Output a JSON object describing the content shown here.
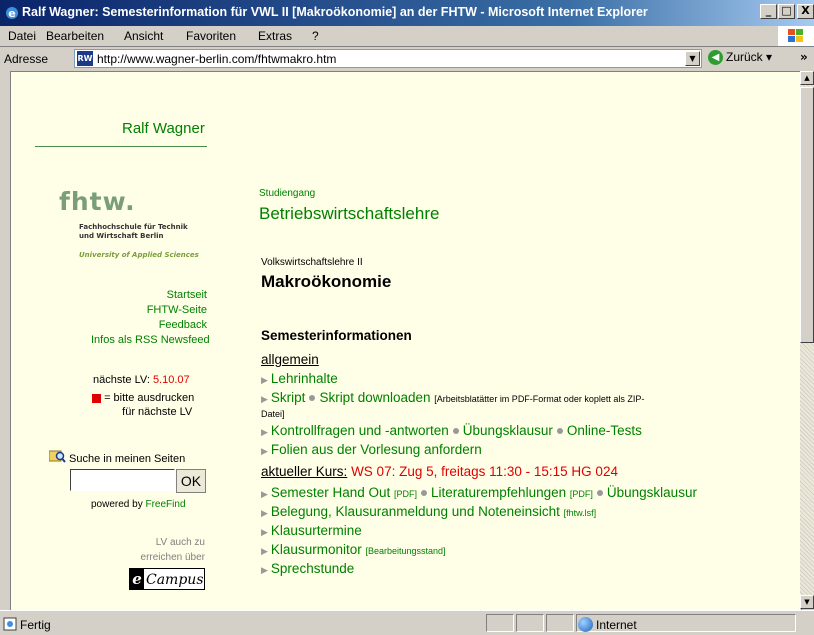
{
  "window": {
    "title": "Ralf Wagner: Semesterinformation für VWL II [Makroökonomie] an der FHTW - Microsoft Internet Explorer",
    "minimize": "_",
    "maximize": "□",
    "close": "X"
  },
  "menu": {
    "items": [
      "Datei",
      "Bearbeiten",
      "Ansicht",
      "Favoriten",
      "Extras",
      "?"
    ]
  },
  "address": {
    "label": "Adresse",
    "favicon": "RW",
    "url": "http://www.wagner-berlin.com/fhtwmakro.htm",
    "back_label": "Zurück",
    "more": "»"
  },
  "sidebar": {
    "name": "Ralf Wagner",
    "logo": "fhtw.",
    "logo_sub1": "Fachhochschule für Technik",
    "logo_sub2": "und Wirtschaft Berlin",
    "logo_uni": "University of Applied Sciences",
    "nav": [
      "Startseit",
      "FHTW-Seite",
      "Feedback",
      "Infos als RSS Newsfeed"
    ],
    "next_lv_label": "nächste LV:",
    "next_lv_date": "5.10.07",
    "print_line1": "= bitte ausdrucken",
    "print_line2": "für nächste LV",
    "search_label": "Suche in meinen Seiten",
    "search_value": "",
    "search_button": "OK",
    "powered_by": "powered by",
    "powered_name": "FreeFind",
    "lv_line1": "LV auch zu",
    "lv_line2": "erreichen über",
    "ecampus_e": "e",
    "ecampus_text": "Campus"
  },
  "main": {
    "studiengang_label": "Studiengang",
    "studiengang": "Betriebswirtschaftslehre",
    "course_label": "Volkswirtschaftslehre II",
    "course": "Makroökonomie",
    "section": "Semesterinformationen",
    "allgemein": "allgemein",
    "lehrinhalte": "Lehrinhalte",
    "skript": "Skript",
    "skript_download": "Skript downloaden",
    "skript_note1": "[Arbeitsblatätter im PDF-Format oder koplett als ZIP-",
    "skript_note2": "Datei]",
    "kontrollfragen": "Kontrollfragen und -antworten",
    "uebungsklausur": "Übungsklausur",
    "online_tests": "Online-Tests",
    "folien": "Folien aus der Vorlesung anfordern",
    "kurs_label": "aktueller Kurs:",
    "kurs_value": "WS 07: Zug 5, freitags 11:30 - 15:15 HG 024",
    "handout": "Semester Hand Out",
    "pdf1": "[PDF]",
    "literatur": "Literaturempfehlungen",
    "pdf2": "[PDF]",
    "uebungsklausur2": "Übungsklausur",
    "belegung": "Belegung, Klausuranmeldung und Noteneinsicht",
    "lsf": "[fhtw.lsf]",
    "klausurtermine": "Klausurtermine",
    "klausurmonitor": "Klausurmonitor",
    "bearbeitungsstand": "[Bearbeitungsstand]",
    "sprechstunde": "Sprechstunde"
  },
  "status": {
    "text": "Fertig",
    "zone": "Internet"
  },
  "colors": {
    "page_bg": "#ffffe8",
    "link_green": "#008000",
    "accent_red": "#e00000",
    "titlebar": "#0a246a"
  }
}
